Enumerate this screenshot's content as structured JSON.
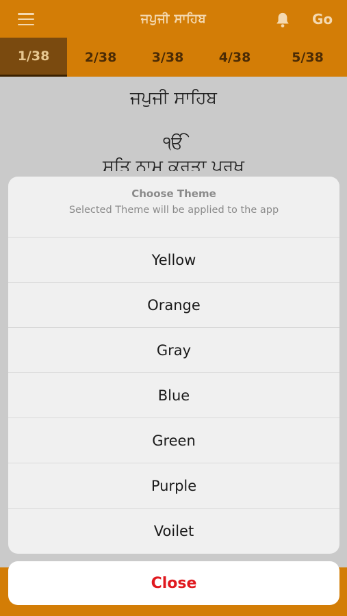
{
  "header": {
    "title": "ਜਪੁਜੀ ਸਾਹਿਬ",
    "menu_icon": "hamburger-menu-icon",
    "bell_icon": "bell-icon",
    "go_label": "Go",
    "color": "#d37d06"
  },
  "tabs": [
    {
      "label": "1/38",
      "active": true
    },
    {
      "label": "2/38",
      "active": false
    },
    {
      "label": "3/38",
      "active": false
    },
    {
      "label": "4/38",
      "active": false
    },
    {
      "label": "5/38",
      "active": false
    }
  ],
  "content": {
    "title": "ਜਪੁਜੀ ਸਾਹਿਬ",
    "ek_onkar": "ੴ",
    "line2": "ਸਤਿ ਨਾਮੁ ਕਰਤਾ ਪੁਰਖੁ"
  },
  "theme_sheet": {
    "heading": "Choose Theme",
    "subtitle": "Selected Theme will be applied to the app",
    "options": [
      "Yellow",
      "Orange",
      "Gray",
      "Blue",
      "Green",
      "Purple",
      "Voilet"
    ],
    "close_label": "Close",
    "close_color": "#e0191f"
  }
}
